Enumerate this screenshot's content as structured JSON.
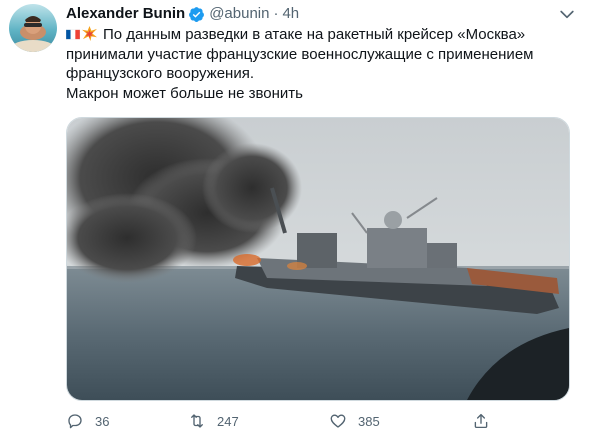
{
  "author": {
    "display_name": "Alexander Bunin",
    "handle": "@abunin",
    "separator": "·",
    "timestamp": "4h",
    "verified": true
  },
  "tweet": {
    "lines": [
      "По данным разведки в атаке на ракетный крейсер «Москва»",
      "принимали участие французские военнослужащие с применением",
      "французского вооружения.",
      "Макрон может больше не звонить"
    ],
    "leading_emoji": [
      "flag-france-icon",
      "collision-icon"
    ]
  },
  "media": {
    "kind": "photo"
  },
  "actions": {
    "reply_count": "36",
    "retweet_count": "247",
    "like_count": "385"
  },
  "colors": {
    "text": "#0f1419",
    "muted": "#536471",
    "verified": "#1d9bf0",
    "border": "#cfd9de"
  }
}
